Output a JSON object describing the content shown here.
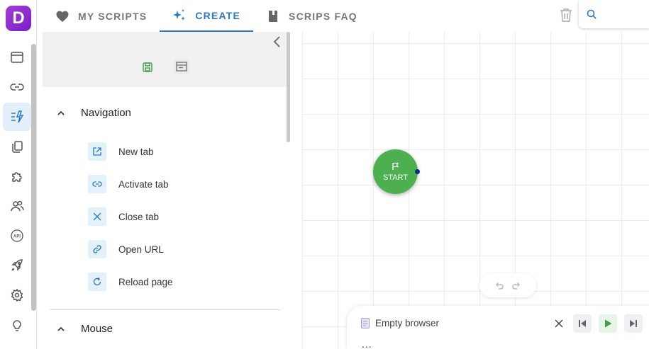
{
  "app": {
    "logo_letter": "D"
  },
  "tabs": [
    {
      "label": "MY SCRIPTS",
      "icon": "heart-icon",
      "active": false
    },
    {
      "label": "CREATE",
      "icon": "sparkle-icon",
      "active": true
    },
    {
      "label": "SCRIPS FAQ",
      "icon": "book-icon",
      "active": false
    }
  ],
  "search": {
    "placeholder": ""
  },
  "rail": {
    "items": [
      "browser-window-icon",
      "link-icon",
      "create-icon",
      "copy-icon",
      "puzzle-icon",
      "users-icon",
      "api-icon",
      "rocket-icon",
      "settings-icon",
      "lightbulb-icon"
    ],
    "active_index": 2
  },
  "panel": {
    "sections": [
      {
        "label": "Navigation",
        "expanded": true,
        "actions": [
          {
            "label": "New tab",
            "icon": "open-external-icon"
          },
          {
            "label": "Activate tab",
            "icon": "link-icon"
          },
          {
            "label": "Close tab",
            "icon": "close-icon"
          },
          {
            "label": "Open URL",
            "icon": "link-chain-icon"
          },
          {
            "label": "Reload page",
            "icon": "reload-icon"
          }
        ]
      },
      {
        "label": "Mouse",
        "expanded": true,
        "actions": []
      }
    ]
  },
  "canvas": {
    "start_label": "START"
  },
  "player": {
    "browser_label": "Empty browser",
    "more": "..."
  },
  "colors": {
    "accent": "#2a79c6",
    "start_node": "#4caf50",
    "logo": "#8e2bd0",
    "play": "#43a047"
  }
}
